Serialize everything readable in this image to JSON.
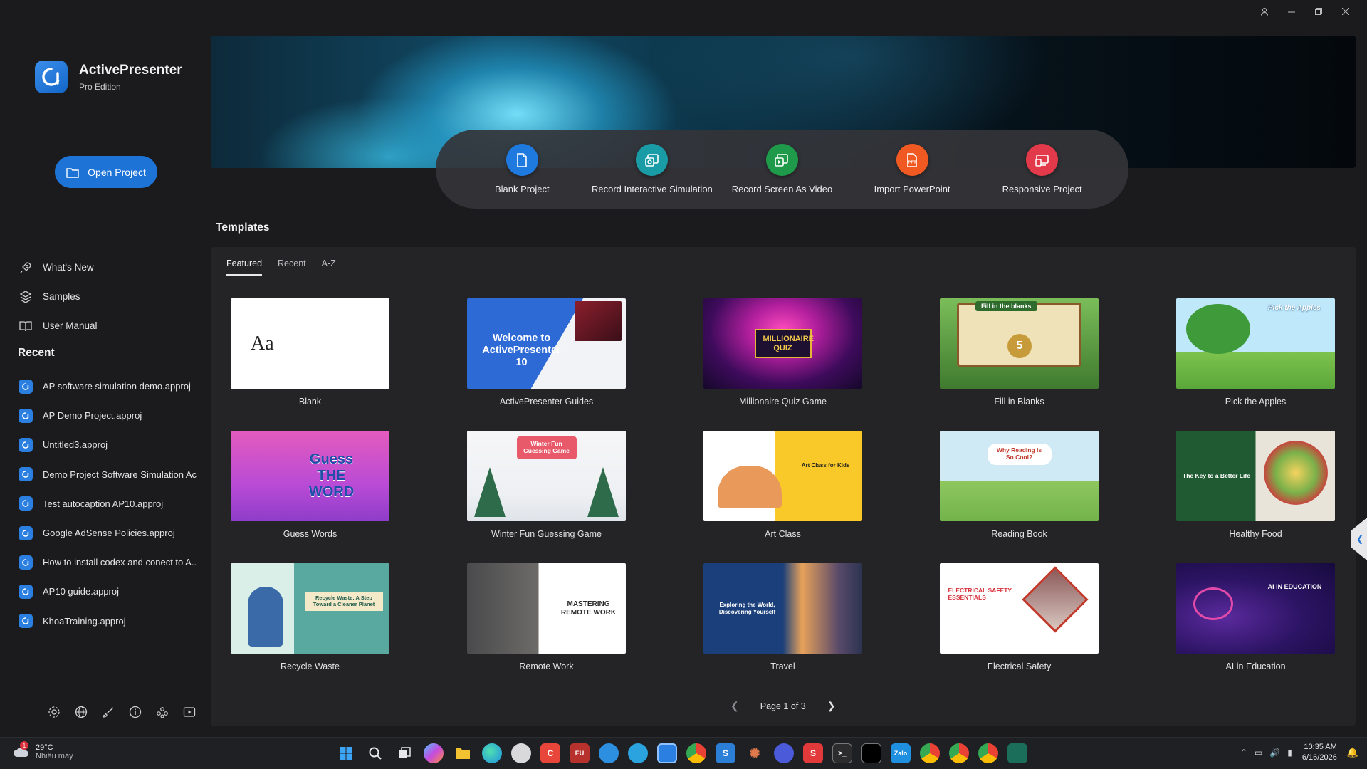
{
  "window": {
    "controls": [
      "account-icon",
      "minimize-icon",
      "restore-icon",
      "close-icon"
    ]
  },
  "brand": {
    "title": "ActivePresenter",
    "edition": "Pro Edition"
  },
  "sidebar": {
    "open_project": "Open Project",
    "nav": [
      {
        "label": "What's New",
        "icon": "rocket-icon"
      },
      {
        "label": "Samples",
        "icon": "samples-icon"
      },
      {
        "label": "User Manual",
        "icon": "book-icon"
      }
    ],
    "recent_heading": "Recent",
    "recent": [
      "AP software simulation demo.approj",
      "AP Demo Project.approj",
      "Untitled3.approj",
      "Demo Project Software Simulation Ac...",
      "Test autocaption AP10.approj",
      "Google AdSense Policies.approj",
      "How to install codex and conect to A...",
      "AP10 guide.approj",
      "KhoaTraining.approj"
    ],
    "bottom_icons": [
      "settings-icon",
      "globe-icon",
      "brush-icon",
      "info-icon",
      "community-icon",
      "video-icon"
    ]
  },
  "actions": [
    {
      "label": "Blank Project",
      "color": "#1f7ae0",
      "icon": "document-icon"
    },
    {
      "label": "Record Interactive Simulation",
      "color": "#1a9ca6",
      "icon": "record-simulation-icon"
    },
    {
      "label": "Record Screen As Video",
      "color": "#1f9a4a",
      "icon": "record-video-icon"
    },
    {
      "label": "Import PowerPoint",
      "color": "#f05a22",
      "icon": "ppt-icon"
    },
    {
      "label": "Responsive Project",
      "color": "#e23a4a",
      "icon": "responsive-icon"
    }
  ],
  "templates": {
    "heading": "Templates",
    "tabs": [
      "Featured",
      "Recent",
      "A-Z"
    ],
    "active_tab": "Featured",
    "items": [
      {
        "name": "Blank",
        "thumb_text": "Aa"
      },
      {
        "name": "ActivePresenter Guides",
        "thumb_text": "Welcome to ActivePresenter 10"
      },
      {
        "name": "Millionaire Quiz Game",
        "thumb_text": "MILLIONAIRE QUIZ"
      },
      {
        "name": "Fill in Blanks",
        "thumb_text": "Fill in the blanks"
      },
      {
        "name": "Pick the Apples",
        "thumb_text": "Pick the Apples"
      },
      {
        "name": "Guess Words",
        "thumb_text": "Guess THE WORD"
      },
      {
        "name": "Winter Fun Guessing Game",
        "thumb_text": "Winter Fun Guessing Game"
      },
      {
        "name": "Art Class",
        "thumb_text": "Art Class for Kids"
      },
      {
        "name": "Reading Book",
        "thumb_text": "Why Reading Is So Cool?"
      },
      {
        "name": "Healthy Food",
        "thumb_text": "The Key to a Better Life"
      },
      {
        "name": "Recycle Waste",
        "thumb_text": "Recycle Waste: A Step Toward a Cleaner Planet"
      },
      {
        "name": "Remote Work",
        "thumb_text": "MASTERING REMOTE WORK"
      },
      {
        "name": "Travel",
        "thumb_text": "Exploring the World, Discovering Yourself"
      },
      {
        "name": "Electrical Safety",
        "thumb_text": "ELECTRICAL SAFETY ESSENTIALS"
      },
      {
        "name": "AI in Education",
        "thumb_text": "AI IN EDUCATION"
      }
    ],
    "pager": "Page 1 of 3"
  },
  "taskbar": {
    "weather_temp": "29°C",
    "weather_desc": "Nhiều mây",
    "weather_badge": "1",
    "time": "10:35 AM",
    "date": "6/16/2026"
  }
}
